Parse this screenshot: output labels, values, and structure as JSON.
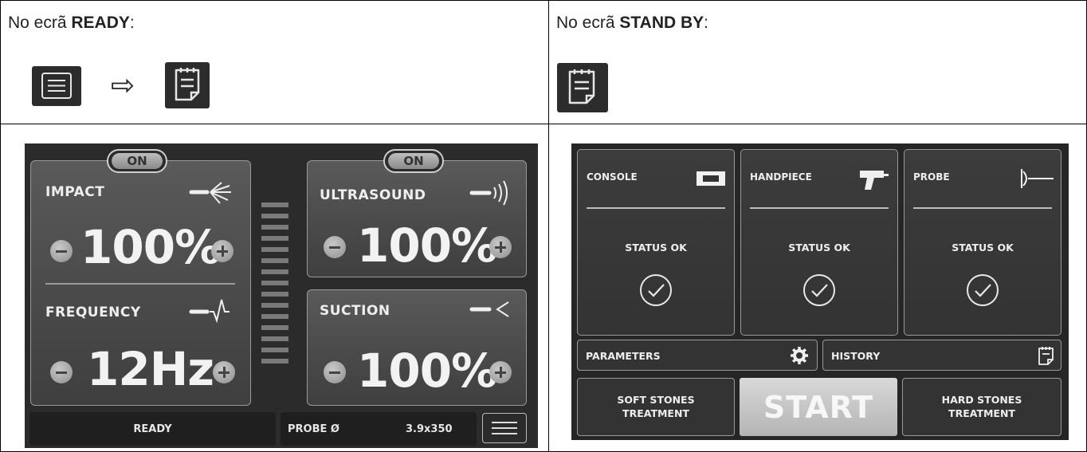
{
  "left_cell": {
    "intro_prefix": "No ecrã ",
    "intro_bold": "READY",
    "intro_suffix": ":",
    "arrow": "⇨",
    "icons": [
      "menu-icon",
      "notepad-icon"
    ]
  },
  "right_cell": {
    "intro_prefix": "No ecrã ",
    "intro_bold": "STAND BY",
    "intro_suffix": ":",
    "icons": [
      "notepad-icon"
    ]
  },
  "ready_screen": {
    "impact_panel": {
      "on_label": "ON",
      "impact": {
        "label": "IMPACT",
        "value": "100%",
        "icon": "impact-icon"
      },
      "frequency": {
        "label": "FREQUENCY",
        "value": "12Hz",
        "icon": "frequency-icon"
      }
    },
    "ultrasound_panel": {
      "on_label": "ON",
      "label": "ULTRASOUND",
      "value": "100%",
      "icon": "ultrasound-icon"
    },
    "suction_panel": {
      "label": "SUCTION",
      "value": "100%",
      "icon": "suction-icon"
    },
    "level_indicator": {
      "segments": 13,
      "icon": "level-bars"
    },
    "status": "READY",
    "probe_label": "PROBE Ø",
    "probe_value": "3.9x350",
    "menu_icon": "menu-icon"
  },
  "standby_screen": {
    "cards": [
      {
        "title": "CONSOLE",
        "status": "STATUS OK",
        "icon": "console-icon"
      },
      {
        "title": "HANDPIECE",
        "status": "STATUS OK",
        "icon": "handpiece-icon"
      },
      {
        "title": "PROBE",
        "status": "STATUS OK",
        "icon": "probe-icon"
      }
    ],
    "parameters_label": "PARAMETERS",
    "history_label": "HISTORY",
    "soft_stones": "SOFT STONES\nTREATMENT",
    "start": "START",
    "hard_stones": "HARD STONES\nTREATMENT"
  },
  "colors": {
    "screen_bg": "#2b2b2b",
    "panel_border": "#9a9a9a",
    "text_light": "#eeeeee"
  }
}
